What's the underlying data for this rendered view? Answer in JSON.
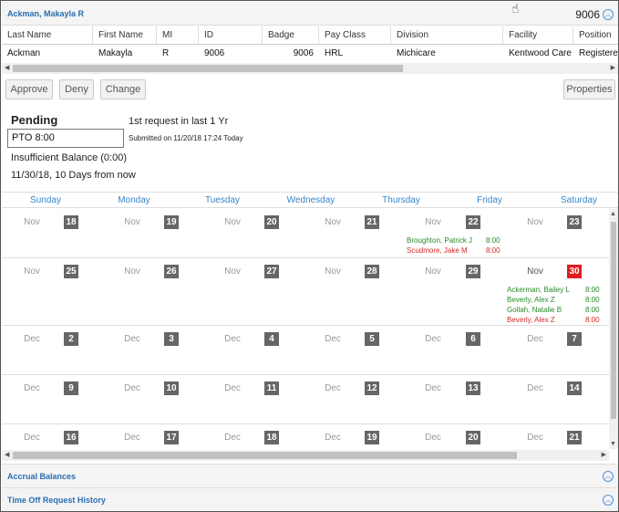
{
  "header": {
    "employee_name": "Ackman, Makayla R",
    "employee_number": "9006"
  },
  "employee_table": {
    "columns": [
      "Last Name",
      "First Name",
      "MI",
      "ID",
      "Badge",
      "Pay Class",
      "Division",
      "Facility",
      "Position"
    ],
    "row": [
      "Ackman",
      "Makayla",
      "R",
      "9006",
      "9006",
      "HRL",
      "Michicare",
      "Kentwood Care",
      "Registered"
    ]
  },
  "actions": {
    "approve": "Approve",
    "deny": "Deny",
    "change": "Change",
    "properties": "Properties"
  },
  "pending": {
    "title": "Pending",
    "request_value": "PTO 8:00",
    "request_count": "1st request in last 1 Yr",
    "submitted": "Submitted on 11/20/18 17:24 Today",
    "balance": "Insufficient Balance (0:00)",
    "date_info": "11/30/18, 10 Days from now"
  },
  "calendar": {
    "days": [
      "Sunday",
      "Monday",
      "Tuesday",
      "Wednesday",
      "Thursday",
      "Friday",
      "Saturday"
    ],
    "weeks": [
      {
        "cells": [
          {
            "month": "Nov",
            "date": "18"
          },
          {
            "month": "Nov",
            "date": "19"
          },
          {
            "month": "Nov",
            "date": "20"
          },
          {
            "month": "Nov",
            "date": "21"
          },
          {
            "month": "Nov",
            "date": "22"
          },
          {
            "month": "",
            "date": ""
          },
          {
            "month": "Nov",
            "date": "23"
          }
        ]
      },
      {
        "cells": [
          {
            "month": "Nov",
            "date": "25"
          },
          {
            "month": "Nov",
            "date": "26"
          },
          {
            "month": "Nov",
            "date": "27"
          },
          {
            "month": "Nov",
            "date": "28"
          },
          {
            "month": "Nov",
            "date": "29"
          },
          {
            "month": "",
            "date": ""
          },
          {
            "month": "Nov",
            "date": "30"
          }
        ]
      },
      {
        "cells": [
          {
            "month": "Dec",
            "date": "2"
          },
          {
            "month": "Dec",
            "date": "3"
          },
          {
            "month": "Dec",
            "date": "4"
          },
          {
            "month": "Dec",
            "date": "5"
          },
          {
            "month": "Dec",
            "date": "6"
          },
          {
            "month": "",
            "date": ""
          },
          {
            "month": "Dec",
            "date": "7"
          }
        ]
      },
      {
        "cells": [
          {
            "month": "Dec",
            "date": "9"
          },
          {
            "month": "Dec",
            "date": "10"
          },
          {
            "month": "Dec",
            "date": "11"
          },
          {
            "month": "Dec",
            "date": "12"
          },
          {
            "month": "Dec",
            "date": "13"
          },
          {
            "month": "",
            "date": ""
          },
          {
            "month": "Dec",
            "date": "14"
          }
        ]
      },
      {
        "cells": [
          {
            "month": "Dec",
            "date": "16"
          },
          {
            "month": "Dec",
            "date": "17"
          },
          {
            "month": "Dec",
            "date": "18"
          },
          {
            "month": "Dec",
            "date": "19"
          },
          {
            "month": "Dec",
            "date": "20"
          },
          {
            "month": "",
            "date": ""
          },
          {
            "month": "Dec",
            "date": "21"
          }
        ]
      }
    ],
    "entries_week1": [
      {
        "name": "Broughton, Patrick J",
        "hours": "8:00",
        "status": "approved"
      },
      {
        "name": "Scudmore, Jake M",
        "hours": "8:00",
        "status": "denied"
      }
    ],
    "entries_week2": [
      {
        "name": "Ackerman, Bailey L",
        "hours": "8:00",
        "status": "approved"
      },
      {
        "name": "Beverly, Alex Z",
        "hours": "8:00",
        "status": "approved"
      },
      {
        "name": "Gollah, Natalie B",
        "hours": "8:00",
        "status": "approved"
      },
      {
        "name": "Beverly, Alex Z",
        "hours": "8:00",
        "status": "denied"
      }
    ]
  },
  "sections": {
    "accrual": "Accrual Balances",
    "history": "Time Off Request History"
  },
  "colors": {
    "link": "#2a6fb0",
    "approved": "#2a8a2a",
    "denied": "#d42a2a",
    "today": "#e01e1e"
  }
}
